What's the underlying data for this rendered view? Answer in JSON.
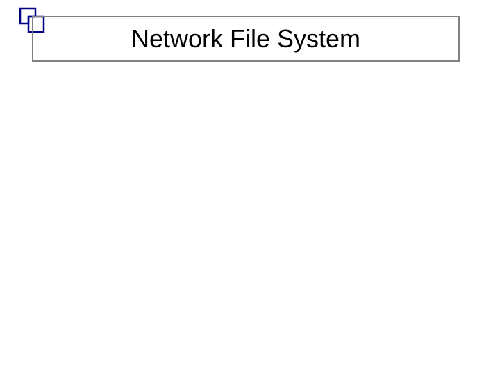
{
  "slide": {
    "title": "Network File System"
  },
  "icon": {
    "name": "overlapping-squares",
    "stroke_color": "#000080",
    "fill_color": "#ffffff"
  }
}
